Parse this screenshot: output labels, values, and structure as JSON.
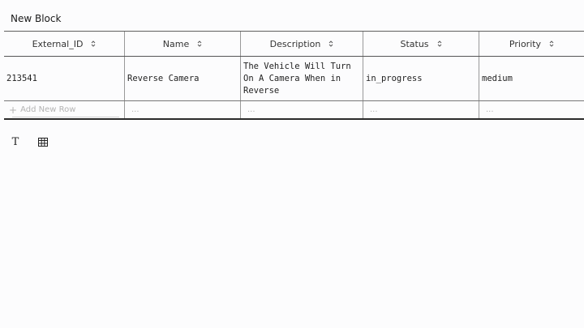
{
  "block": {
    "title": "New Block"
  },
  "table": {
    "columns": [
      {
        "label": "External_ID",
        "sort_icon": "sort-icon"
      },
      {
        "label": "Name",
        "sort_icon": "sort-icon"
      },
      {
        "label": "Description",
        "sort_icon": "sort-icon"
      },
      {
        "label": "Status",
        "sort_icon": "sort-icon"
      },
      {
        "label": "Priority",
        "sort_icon": "sort-icon"
      }
    ],
    "rows": [
      {
        "cells": [
          "213541",
          "Reverse Camera",
          "The Vehicle Will Turn On A Camera When in Reverse",
          "in_progress",
          "medium"
        ]
      }
    ],
    "add_row_label": "Add New Row",
    "placeholder": "..."
  },
  "toolbar": {
    "tools": [
      "text-icon",
      "table-icon"
    ]
  },
  "colors": {
    "background": "#fcfcfd",
    "border": "#5f5f5f",
    "placeholder_text": "#b3b3b3"
  }
}
